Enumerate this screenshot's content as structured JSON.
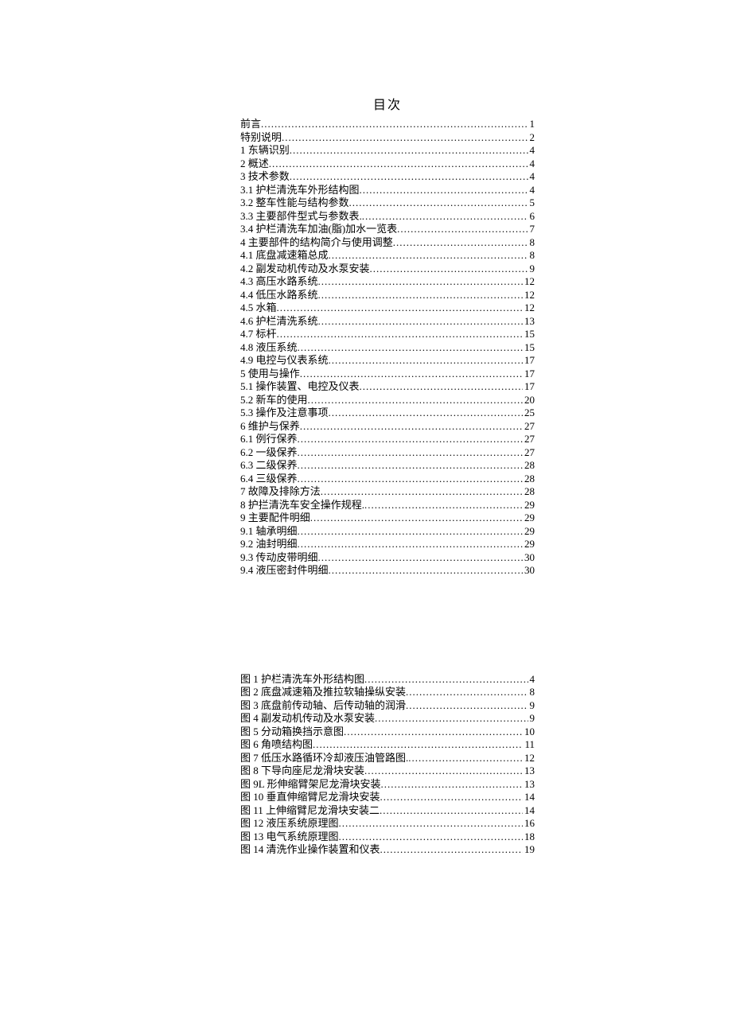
{
  "title": "目次",
  "toc": [
    {
      "label": "前言",
      "page": "1"
    },
    {
      "label": "特别说明",
      "page": "2"
    },
    {
      "label": "1 东辆识别",
      "page": "4"
    },
    {
      "label": "2 概述",
      "page": "4"
    },
    {
      "label": "3 技术参数",
      "page": "4"
    },
    {
      "label": "3.1 护栏清洗车外形结构图",
      "page": "4"
    },
    {
      "label": "3.2 整车性能与结构参数",
      "page": "5"
    },
    {
      "label": "3.3 主要部件型式与参数表.",
      "page": "6"
    },
    {
      "label": "3.4 护栏清洗车加油(脂)加水一览表",
      "page": "7"
    },
    {
      "label": "4 主要部件的结构简介与使用调整",
      "page": "8"
    },
    {
      "label": "4.1 底盘减速箱总成",
      "page": "8"
    },
    {
      "label": "4.2 副发动机传动及水泵安装",
      "page": "9"
    },
    {
      "label": "4.3 高压水路系统",
      "page": "12"
    },
    {
      "label": "4.4 低压水路系统",
      "page": "12"
    },
    {
      "label": "4.5 水箱",
      "page": "12"
    },
    {
      "label": "4.6 护栏清洗系统",
      "page": "13"
    },
    {
      "label": "4.7 标杆",
      "page": "15"
    },
    {
      "label": "4.8 液压系统",
      "page": "15"
    },
    {
      "label": "4.9 电控与仪表系统",
      "page": "17"
    },
    {
      "label": "5 使用与操作",
      "page": "17"
    },
    {
      "label": "5.1 操作装置、电控及仪表",
      "page": "17"
    },
    {
      "label": "5.2 新车的使用",
      "page": "20"
    },
    {
      "label": "5.3 操作及注意事项",
      "page": "25"
    },
    {
      "label": "6 维护与保养",
      "page": "27"
    },
    {
      "label": "6.1 例行保养",
      "page": "27"
    },
    {
      "label": "6.2 一级保养",
      "page": "27"
    },
    {
      "label": "6.3 二级保养",
      "page": "28"
    },
    {
      "label": "6.4 三级保养",
      "page": "28"
    },
    {
      "label": "7 故障及排除方法",
      "page": "28"
    },
    {
      "label": "8 护拦清洗车安全操作规程.",
      "page": "29"
    },
    {
      "label": "9 主要配件明细",
      "page": "29"
    },
    {
      "label": "9.1 轴承明细",
      "page": "29"
    },
    {
      "label": "9.2 油封明细",
      "page": "29"
    },
    {
      "label": "9.3 传动皮带明细",
      "page": "30"
    },
    {
      "label": "9.4 液压密封件明细",
      "page": "30"
    }
  ],
  "figures": [
    {
      "label": "图 1 护栏清洗车外形结构图",
      "page": "4"
    },
    {
      "label": "图 2 底盘减速箱及推拉软轴操纵安装",
      "page": "8"
    },
    {
      "label": "图 3 底盘前传动轴、后传动轴的润滑",
      "page": "9"
    },
    {
      "label": "图 4 副发动机传动及水泵安装",
      "page": "9"
    },
    {
      "label": "图 5 分动箱换挡示意图",
      "page": "10"
    },
    {
      "label": "图 6 角喷结构图",
      "page": "11"
    },
    {
      "label": "图 7 低压水路循环冷却液压油管路图.",
      "page": "12"
    },
    {
      "label": "图 8 下导向座尼龙滑块安装",
      "page": "13"
    },
    {
      "label": "图 9L 形伸缩臂架尼龙滑块安装",
      "page": "13"
    },
    {
      "label": "图 10 垂直伸缩臂尼龙滑块安装",
      "page": "14"
    },
    {
      "label": "图 11 上伸缩臂尼龙滑块安装二",
      "page": "14"
    },
    {
      "label": "图 12 液压系统原理图",
      "page": "16"
    },
    {
      "label": "图 13 电气系统原理图",
      "page": "18"
    },
    {
      "label": "图 14 清洗作业操作装置和仪表",
      "page": "19"
    }
  ],
  "dots": "................................................................................................................................................................"
}
